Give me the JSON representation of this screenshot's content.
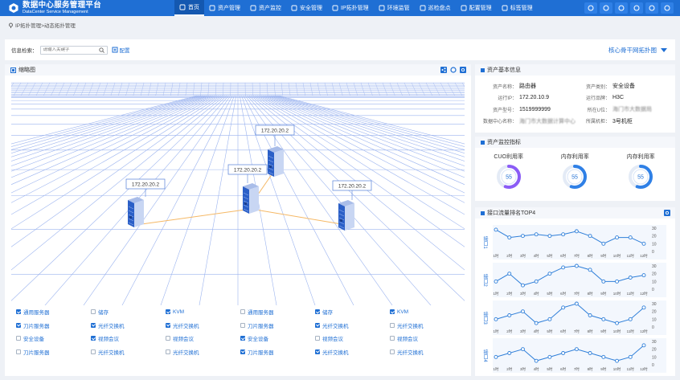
{
  "header": {
    "title": "数据中心服务管理平台",
    "subtitle": "DataCenter Service Management",
    "nav": [
      {
        "label": "首页",
        "icon": "home-icon",
        "active": true
      },
      {
        "label": "资产管理",
        "icon": "asset-icon"
      },
      {
        "label": "资产监控",
        "icon": "monitor-icon"
      },
      {
        "label": "安全管理",
        "icon": "shield-icon"
      },
      {
        "label": "IP拓扑管理",
        "icon": "topology-icon"
      },
      {
        "label": "环境监管",
        "icon": "environment-icon"
      },
      {
        "label": "巡检盘点",
        "icon": "inspection-icon"
      },
      {
        "label": "配置管理",
        "icon": "config-icon"
      },
      {
        "label": "标签管理",
        "icon": "tag-icon"
      }
    ],
    "tools": [
      "twitter-icon",
      "mail-icon",
      "key-icon",
      "transfer-icon",
      "wifi-icon",
      "target-icon"
    ]
  },
  "breadcrumb": "IP拓扑管理>动态拓扑管理",
  "filter": {
    "label": "信息检索：",
    "placeholder": "请输入关键字",
    "config_label": "配置",
    "topo_select": "核心骨干网拓扑图"
  },
  "topology": {
    "title": "缩略图",
    "servers": [
      {
        "ip": "172.20.20.2"
      },
      {
        "ip": "172.20.20.2"
      },
      {
        "ip": "172.20.20.2"
      },
      {
        "ip": "172.20.20.2"
      }
    ]
  },
  "checkboxes": [
    [
      {
        "label": "通用服务器",
        "checked": true
      },
      {
        "label": "储存",
        "checked": false
      },
      {
        "label": "KVM",
        "checked": true
      },
      {
        "label": "通用服务器",
        "checked": false
      },
      {
        "label": "储存",
        "checked": true
      },
      {
        "label": "KVM",
        "checked": true
      }
    ],
    [
      {
        "label": "刀片服务器",
        "checked": true
      },
      {
        "label": "光纤交换机",
        "checked": true
      },
      {
        "label": "光纤交换机",
        "checked": true
      },
      {
        "label": "刀片服务器",
        "checked": false
      },
      {
        "label": "光纤交换机",
        "checked": true
      },
      {
        "label": "光纤交换机",
        "checked": false
      }
    ],
    [
      {
        "label": "安全设备",
        "checked": false
      },
      {
        "label": "视频会议",
        "checked": true
      },
      {
        "label": "视频会议",
        "checked": false
      },
      {
        "label": "安全设备",
        "checked": true
      },
      {
        "label": "视频会议",
        "checked": false
      },
      {
        "label": "视频会议",
        "checked": false
      }
    ],
    [
      {
        "label": "刀片服务器",
        "checked": false
      },
      {
        "label": "光纤交换机",
        "checked": false
      },
      {
        "label": "光纤交换机",
        "checked": false
      },
      {
        "label": "刀片服务器",
        "checked": true
      },
      {
        "label": "光纤交换机",
        "checked": true
      },
      {
        "label": "光纤交换机",
        "checked": false
      }
    ]
  ],
  "asset_info": {
    "title": "资产基本信息",
    "rows": [
      {
        "k1": "资产名称：",
        "v1": "路由器",
        "k2": "资产类别：",
        "v2": "安全设备"
      },
      {
        "k1": "运行IP：",
        "v1": "172.20.10.9",
        "k2": "运行品牌：",
        "v2": "H3C"
      },
      {
        "k1": "资产型号：",
        "v1": "1519999999",
        "k2": "所在U位：",
        "v2": "海门市大数据局"
      },
      {
        "k1": "数据中心名称：",
        "v1": "海门市大数据计算中心",
        "k2": "所属机柜：",
        "v2": "3号机柜"
      }
    ]
  },
  "monitor": {
    "title": "资产监控指标",
    "gauges": [
      {
        "label": "CUO利用率",
        "value": 55
      },
      {
        "label": "内存利用率",
        "value": 55
      },
      {
        "label": "内存利用率",
        "value": 55
      }
    ]
  },
  "traffic": {
    "title": "接口流量排名TOP4",
    "ports": [
      "接口1",
      "接口2",
      "接口3",
      "接口4"
    ],
    "y_ticks": [
      "30",
      "20",
      "10",
      "0"
    ],
    "x_labels": [
      "1时",
      "2时",
      "3时",
      "4时",
      "5时",
      "6时",
      "7时",
      "8时",
      "9时",
      "10时",
      "11时",
      "12时"
    ]
  },
  "colors": {
    "primary": "#1f6fd4",
    "header": "#1f6fd4",
    "link": "#f5b865"
  },
  "chart_data": [
    {
      "type": "line",
      "name": "接口1",
      "x": [
        "1时",
        "2时",
        "3时",
        "4时",
        "5时",
        "6时",
        "7时",
        "8时",
        "9时",
        "10时",
        "11时",
        "12时"
      ],
      "values": [
        28,
        18,
        20,
        22,
        20,
        22,
        26,
        20,
        10,
        18,
        18,
        10
      ],
      "ylim": [
        0,
        30
      ]
    },
    {
      "type": "line",
      "name": "接口2",
      "x": [
        "1时",
        "2时",
        "3时",
        "4时",
        "5时",
        "6时",
        "7时",
        "8时",
        "9时",
        "10时",
        "11时",
        "12时"
      ],
      "values": [
        10,
        20,
        5,
        10,
        20,
        28,
        30,
        25,
        10,
        10,
        15,
        18
      ],
      "ylim": [
        0,
        30
      ]
    },
    {
      "type": "line",
      "name": "接口3",
      "x": [
        "1时",
        "2时",
        "3时",
        "4时",
        "5时",
        "6时",
        "7时",
        "8时",
        "9时",
        "10时",
        "11时",
        "12时"
      ],
      "values": [
        10,
        15,
        20,
        5,
        10,
        25,
        30,
        15,
        10,
        5,
        10,
        25
      ],
      "ylim": [
        0,
        30
      ]
    },
    {
      "type": "line",
      "name": "接口4",
      "x": [
        "1时",
        "2时",
        "3时",
        "4时",
        "5时",
        "6时",
        "7时",
        "8时",
        "9时",
        "10时",
        "11时",
        "12时"
      ],
      "values": [
        10,
        15,
        20,
        5,
        10,
        15,
        20,
        15,
        10,
        5,
        10,
        25
      ],
      "ylim": [
        0,
        30
      ]
    }
  ]
}
